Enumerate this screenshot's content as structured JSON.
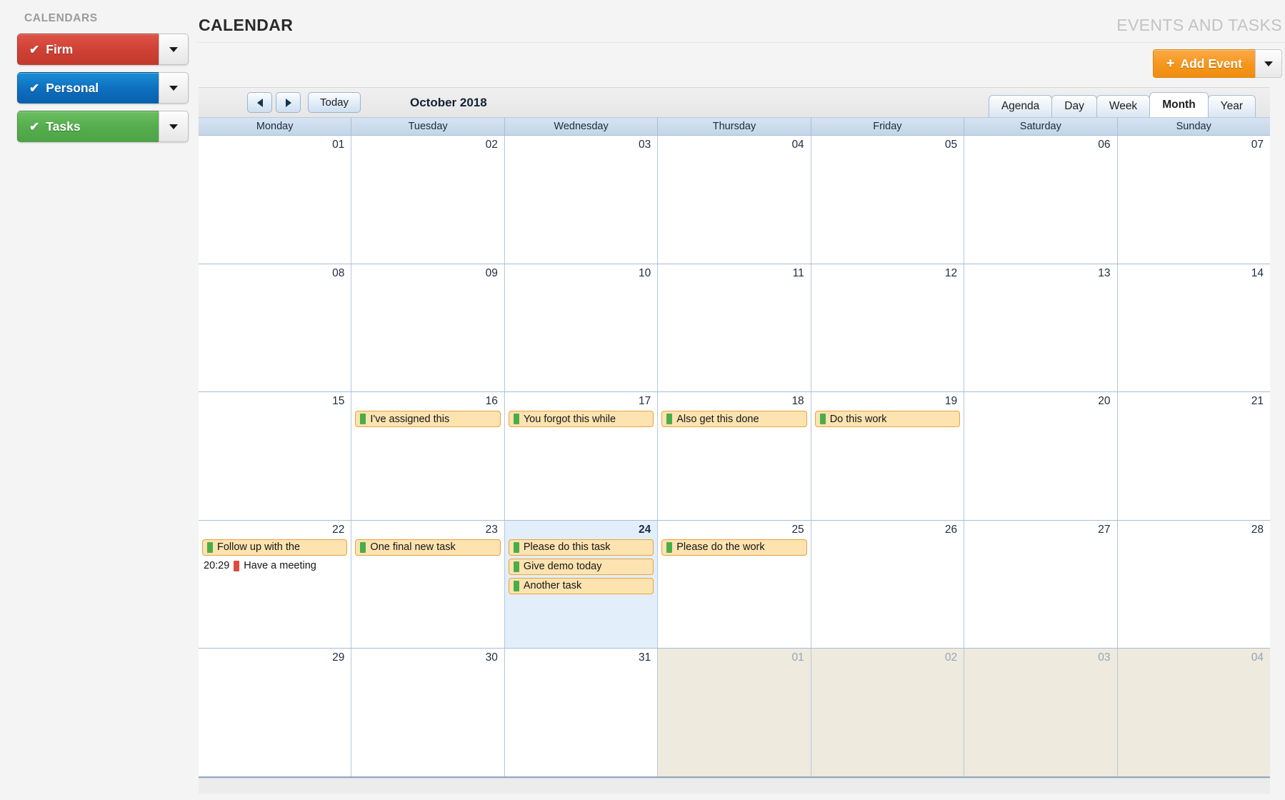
{
  "sidebar": {
    "title": "CALENDARS",
    "calendars": [
      {
        "label": "Firm",
        "color": "#cf4134",
        "check": "✔",
        "caret_icon": "chevron-down-icon"
      },
      {
        "label": "Personal",
        "color": "#0d6fc0",
        "check": "✔",
        "caret_icon": "chevron-down-icon"
      },
      {
        "label": "Tasks",
        "color": "#55ad4d",
        "check": "✔",
        "caret_icon": "chevron-down-icon"
      }
    ]
  },
  "header": {
    "title": "CALENDAR",
    "subtitle": "EVENTS AND TASKS",
    "add_event_label": "Add Event",
    "add_event_plus": "＋"
  },
  "toolbar": {
    "prev_label": "◀",
    "next_label": "▶",
    "today_label": "Today",
    "current_period": "October 2018",
    "views": [
      {
        "label": "Agenda",
        "active": false
      },
      {
        "label": "Day",
        "active": false
      },
      {
        "label": "Week",
        "active": false
      },
      {
        "label": "Month",
        "active": true
      },
      {
        "label": "Year",
        "active": false
      }
    ]
  },
  "grid": {
    "day_names": [
      "Monday",
      "Tuesday",
      "Wednesday",
      "Thursday",
      "Friday",
      "Saturday",
      "Sunday"
    ],
    "weeks": [
      [
        {
          "date": "01",
          "other": false,
          "today": false,
          "events": []
        },
        {
          "date": "02",
          "other": false,
          "today": false,
          "events": []
        },
        {
          "date": "03",
          "other": false,
          "today": false,
          "events": []
        },
        {
          "date": "04",
          "other": false,
          "today": false,
          "events": []
        },
        {
          "date": "05",
          "other": false,
          "today": false,
          "events": []
        },
        {
          "date": "06",
          "other": false,
          "today": false,
          "events": []
        },
        {
          "date": "07",
          "other": false,
          "today": false,
          "events": []
        }
      ],
      [
        {
          "date": "08",
          "other": false,
          "today": false,
          "events": []
        },
        {
          "date": "09",
          "other": false,
          "today": false,
          "events": []
        },
        {
          "date": "10",
          "other": false,
          "today": false,
          "events": []
        },
        {
          "date": "11",
          "other": false,
          "today": false,
          "events": []
        },
        {
          "date": "12",
          "other": false,
          "today": false,
          "events": []
        },
        {
          "date": "13",
          "other": false,
          "today": false,
          "events": []
        },
        {
          "date": "14",
          "other": false,
          "today": false,
          "events": []
        }
      ],
      [
        {
          "date": "15",
          "other": false,
          "today": false,
          "events": []
        },
        {
          "date": "16",
          "other": false,
          "today": false,
          "events": [
            {
              "style": "pill",
              "title": "I've assigned this",
              "chip": "#4aad4a",
              "time": ""
            }
          ]
        },
        {
          "date": "17",
          "other": false,
          "today": false,
          "events": [
            {
              "style": "pill",
              "title": "You forgot this while",
              "chip": "#4aad4a",
              "time": ""
            }
          ]
        },
        {
          "date": "18",
          "other": false,
          "today": false,
          "events": [
            {
              "style": "pill",
              "title": "Also get this done",
              "chip": "#4aad4a",
              "time": ""
            }
          ]
        },
        {
          "date": "19",
          "other": false,
          "today": false,
          "events": [
            {
              "style": "pill",
              "title": "Do this work",
              "chip": "#4aad4a",
              "time": ""
            }
          ]
        },
        {
          "date": "20",
          "other": false,
          "today": false,
          "events": []
        },
        {
          "date": "21",
          "other": false,
          "today": false,
          "events": []
        }
      ],
      [
        {
          "date": "22",
          "other": false,
          "today": false,
          "events": [
            {
              "style": "pill",
              "title": "Follow up with the",
              "chip": "#4aad4a",
              "time": ""
            },
            {
              "style": "plain",
              "title": "Have a meeting",
              "chip": "#e04a3f",
              "time": "20:29"
            }
          ]
        },
        {
          "date": "23",
          "other": false,
          "today": false,
          "events": [
            {
              "style": "pill",
              "title": "One final new task",
              "chip": "#4aad4a",
              "time": ""
            }
          ]
        },
        {
          "date": "24",
          "other": false,
          "today": true,
          "events": [
            {
              "style": "pill",
              "title": "Please do this task",
              "chip": "#4aad4a",
              "time": ""
            },
            {
              "style": "pill",
              "title": "Give demo today",
              "chip": "#4aad4a",
              "time": ""
            },
            {
              "style": "pill",
              "title": "Another task",
              "chip": "#4aad4a",
              "time": ""
            }
          ]
        },
        {
          "date": "25",
          "other": false,
          "today": false,
          "events": [
            {
              "style": "pill",
              "title": "Please do the work",
              "chip": "#4aad4a",
              "time": ""
            }
          ]
        },
        {
          "date": "26",
          "other": false,
          "today": false,
          "events": []
        },
        {
          "date": "27",
          "other": false,
          "today": false,
          "events": []
        },
        {
          "date": "28",
          "other": false,
          "today": false,
          "events": []
        }
      ],
      [
        {
          "date": "29",
          "other": false,
          "today": false,
          "events": []
        },
        {
          "date": "30",
          "other": false,
          "today": false,
          "events": []
        },
        {
          "date": "31",
          "other": false,
          "today": false,
          "events": []
        },
        {
          "date": "01",
          "other": true,
          "today": false,
          "events": []
        },
        {
          "date": "02",
          "other": true,
          "today": false,
          "events": []
        },
        {
          "date": "03",
          "other": true,
          "today": false,
          "events": []
        },
        {
          "date": "04",
          "other": true,
          "today": false,
          "events": []
        }
      ]
    ]
  }
}
